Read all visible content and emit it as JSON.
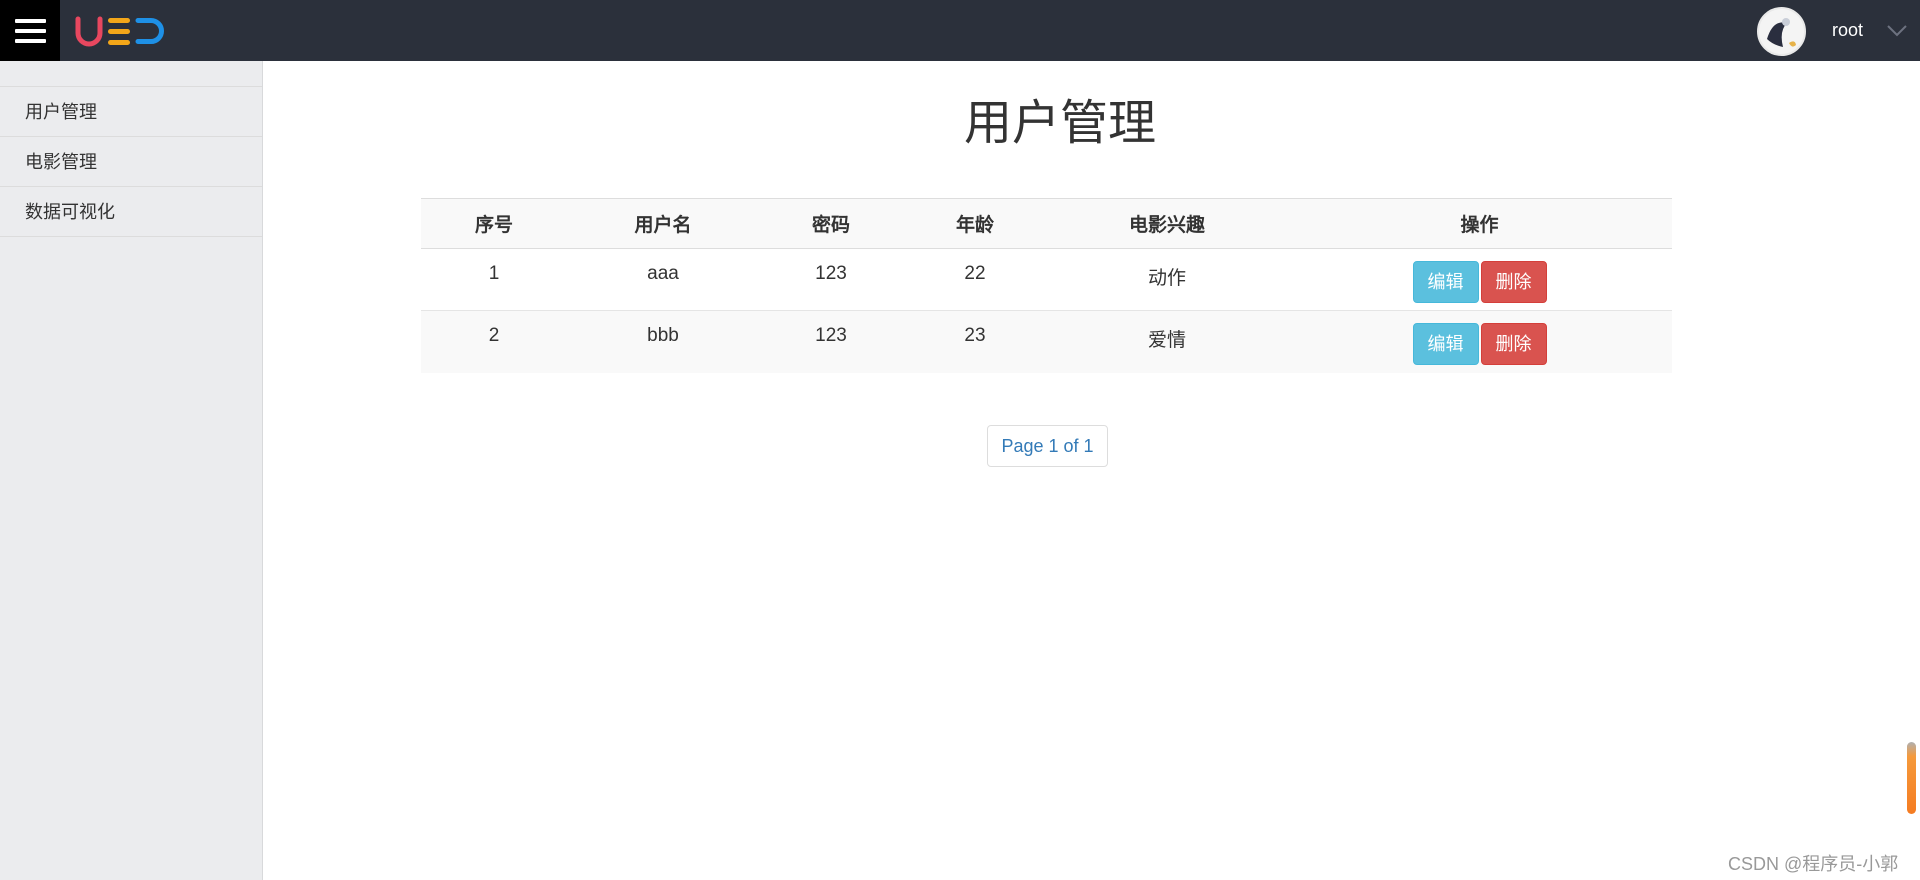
{
  "topbar": {
    "logo_text": "UED",
    "username": "root"
  },
  "sidebar": {
    "items": [
      {
        "label": "用户管理"
      },
      {
        "label": "电影管理"
      },
      {
        "label": "数据可视化"
      }
    ]
  },
  "main": {
    "title": "用户管理",
    "table": {
      "headers": [
        "序号",
        "用户名",
        "密码",
        "年龄",
        "电影兴趣",
        "操作"
      ],
      "rows": [
        {
          "id": "1",
          "username": "aaa",
          "password": "123",
          "age": "22",
          "interest": "动作"
        },
        {
          "id": "2",
          "username": "bbb",
          "password": "123",
          "age": "23",
          "interest": "爱情"
        }
      ],
      "edit_label": "编辑",
      "delete_label": "删除"
    },
    "pagination": "Page 1 of 1"
  },
  "watermark": "CSDN @程序员-小郭",
  "colors": {
    "topbar": "#2b303b",
    "sidebar": "#ebecee",
    "edit_button": "#5bc0de",
    "delete_button": "#d9534f",
    "link": "#337ab7"
  }
}
